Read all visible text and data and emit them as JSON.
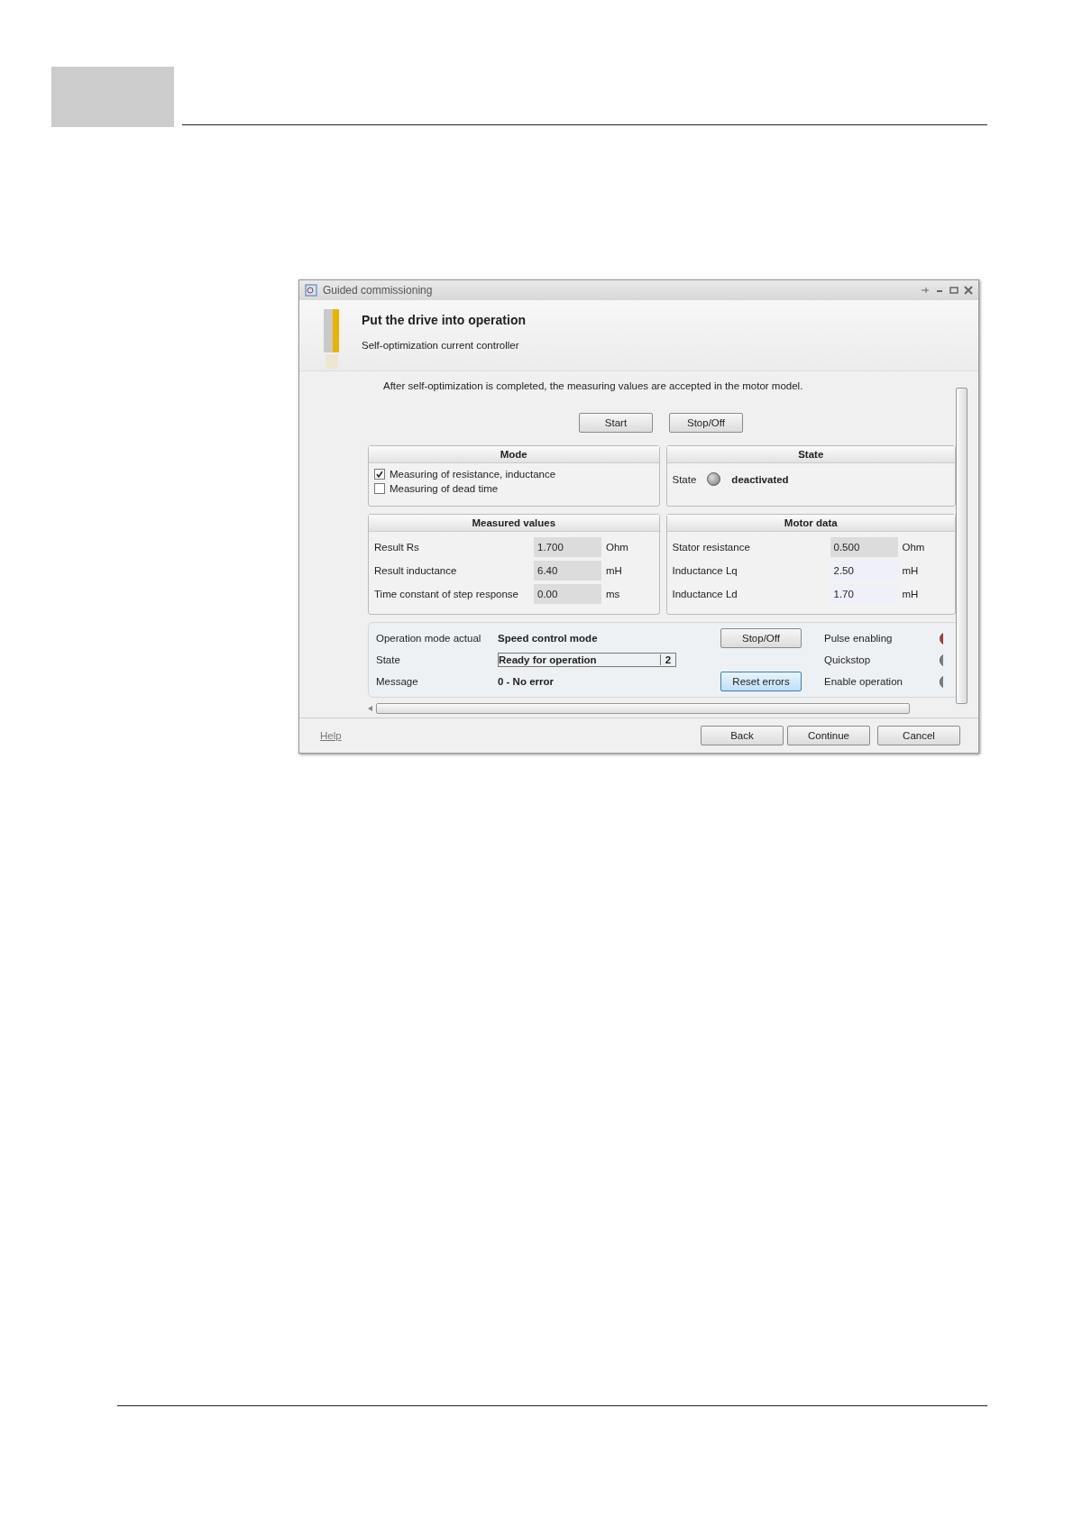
{
  "window": {
    "title": "Guided commissioning"
  },
  "header": {
    "title": "Put the drive into operation",
    "subtitle": "Self-optimization current controller"
  },
  "intro": "After self-optimization is completed, the measuring values are accepted in the motor model.",
  "actions": [
    "Start",
    "Stop/Off"
  ],
  "mode": {
    "title": "Mode",
    "options": [
      {
        "label": "Measuring of resistance, inductance",
        "checked": true
      },
      {
        "label": "Measuring of dead time",
        "checked": false
      }
    ]
  },
  "state_panel": {
    "title": "State",
    "label": "State",
    "value": "deactivated",
    "active": false
  },
  "measured_values": {
    "title": "Measured values",
    "rows": [
      {
        "label": "Result Rs",
        "value": "1.700",
        "unit": "Ohm",
        "disabled": true
      },
      {
        "label": "Result inductance",
        "value": "6.40",
        "unit": "mH",
        "disabled": true
      },
      {
        "label": "Time constant of step response",
        "value": "0.00",
        "unit": "ms",
        "disabled": true
      }
    ]
  },
  "motor_data": {
    "title": "Motor data",
    "rows": [
      {
        "label": "Stator resistance",
        "value": "0.500",
        "unit": "Ohm",
        "disabled": true
      },
      {
        "label": "Inductance Lq",
        "value": "2.50",
        "unit": "mH",
        "disabled": false
      },
      {
        "label": "Inductance Ld",
        "value": "1.70",
        "unit": "mH",
        "disabled": false
      }
    ]
  },
  "status": {
    "operation_mode": {
      "label": "Operation mode actual",
      "value": "Speed control mode"
    },
    "state": {
      "label": "State",
      "value": "Ready for operation",
      "code": "2"
    },
    "message": {
      "label": "Message",
      "value": "0 - No error"
    },
    "buttons": [
      {
        "label": "Stop/Off",
        "focused": false
      },
      {
        "label": "Reset errors",
        "focused": true
      }
    ],
    "signals": [
      {
        "label": "Pulse enabling",
        "color": "#c03030"
      },
      {
        "label": "Quickstop",
        "color": "#808080"
      },
      {
        "label": "Enable operation",
        "color": "#808080"
      }
    ]
  },
  "footer": {
    "help": "Help",
    "buttons": [
      "Back",
      "Continue",
      "Cancel"
    ]
  }
}
